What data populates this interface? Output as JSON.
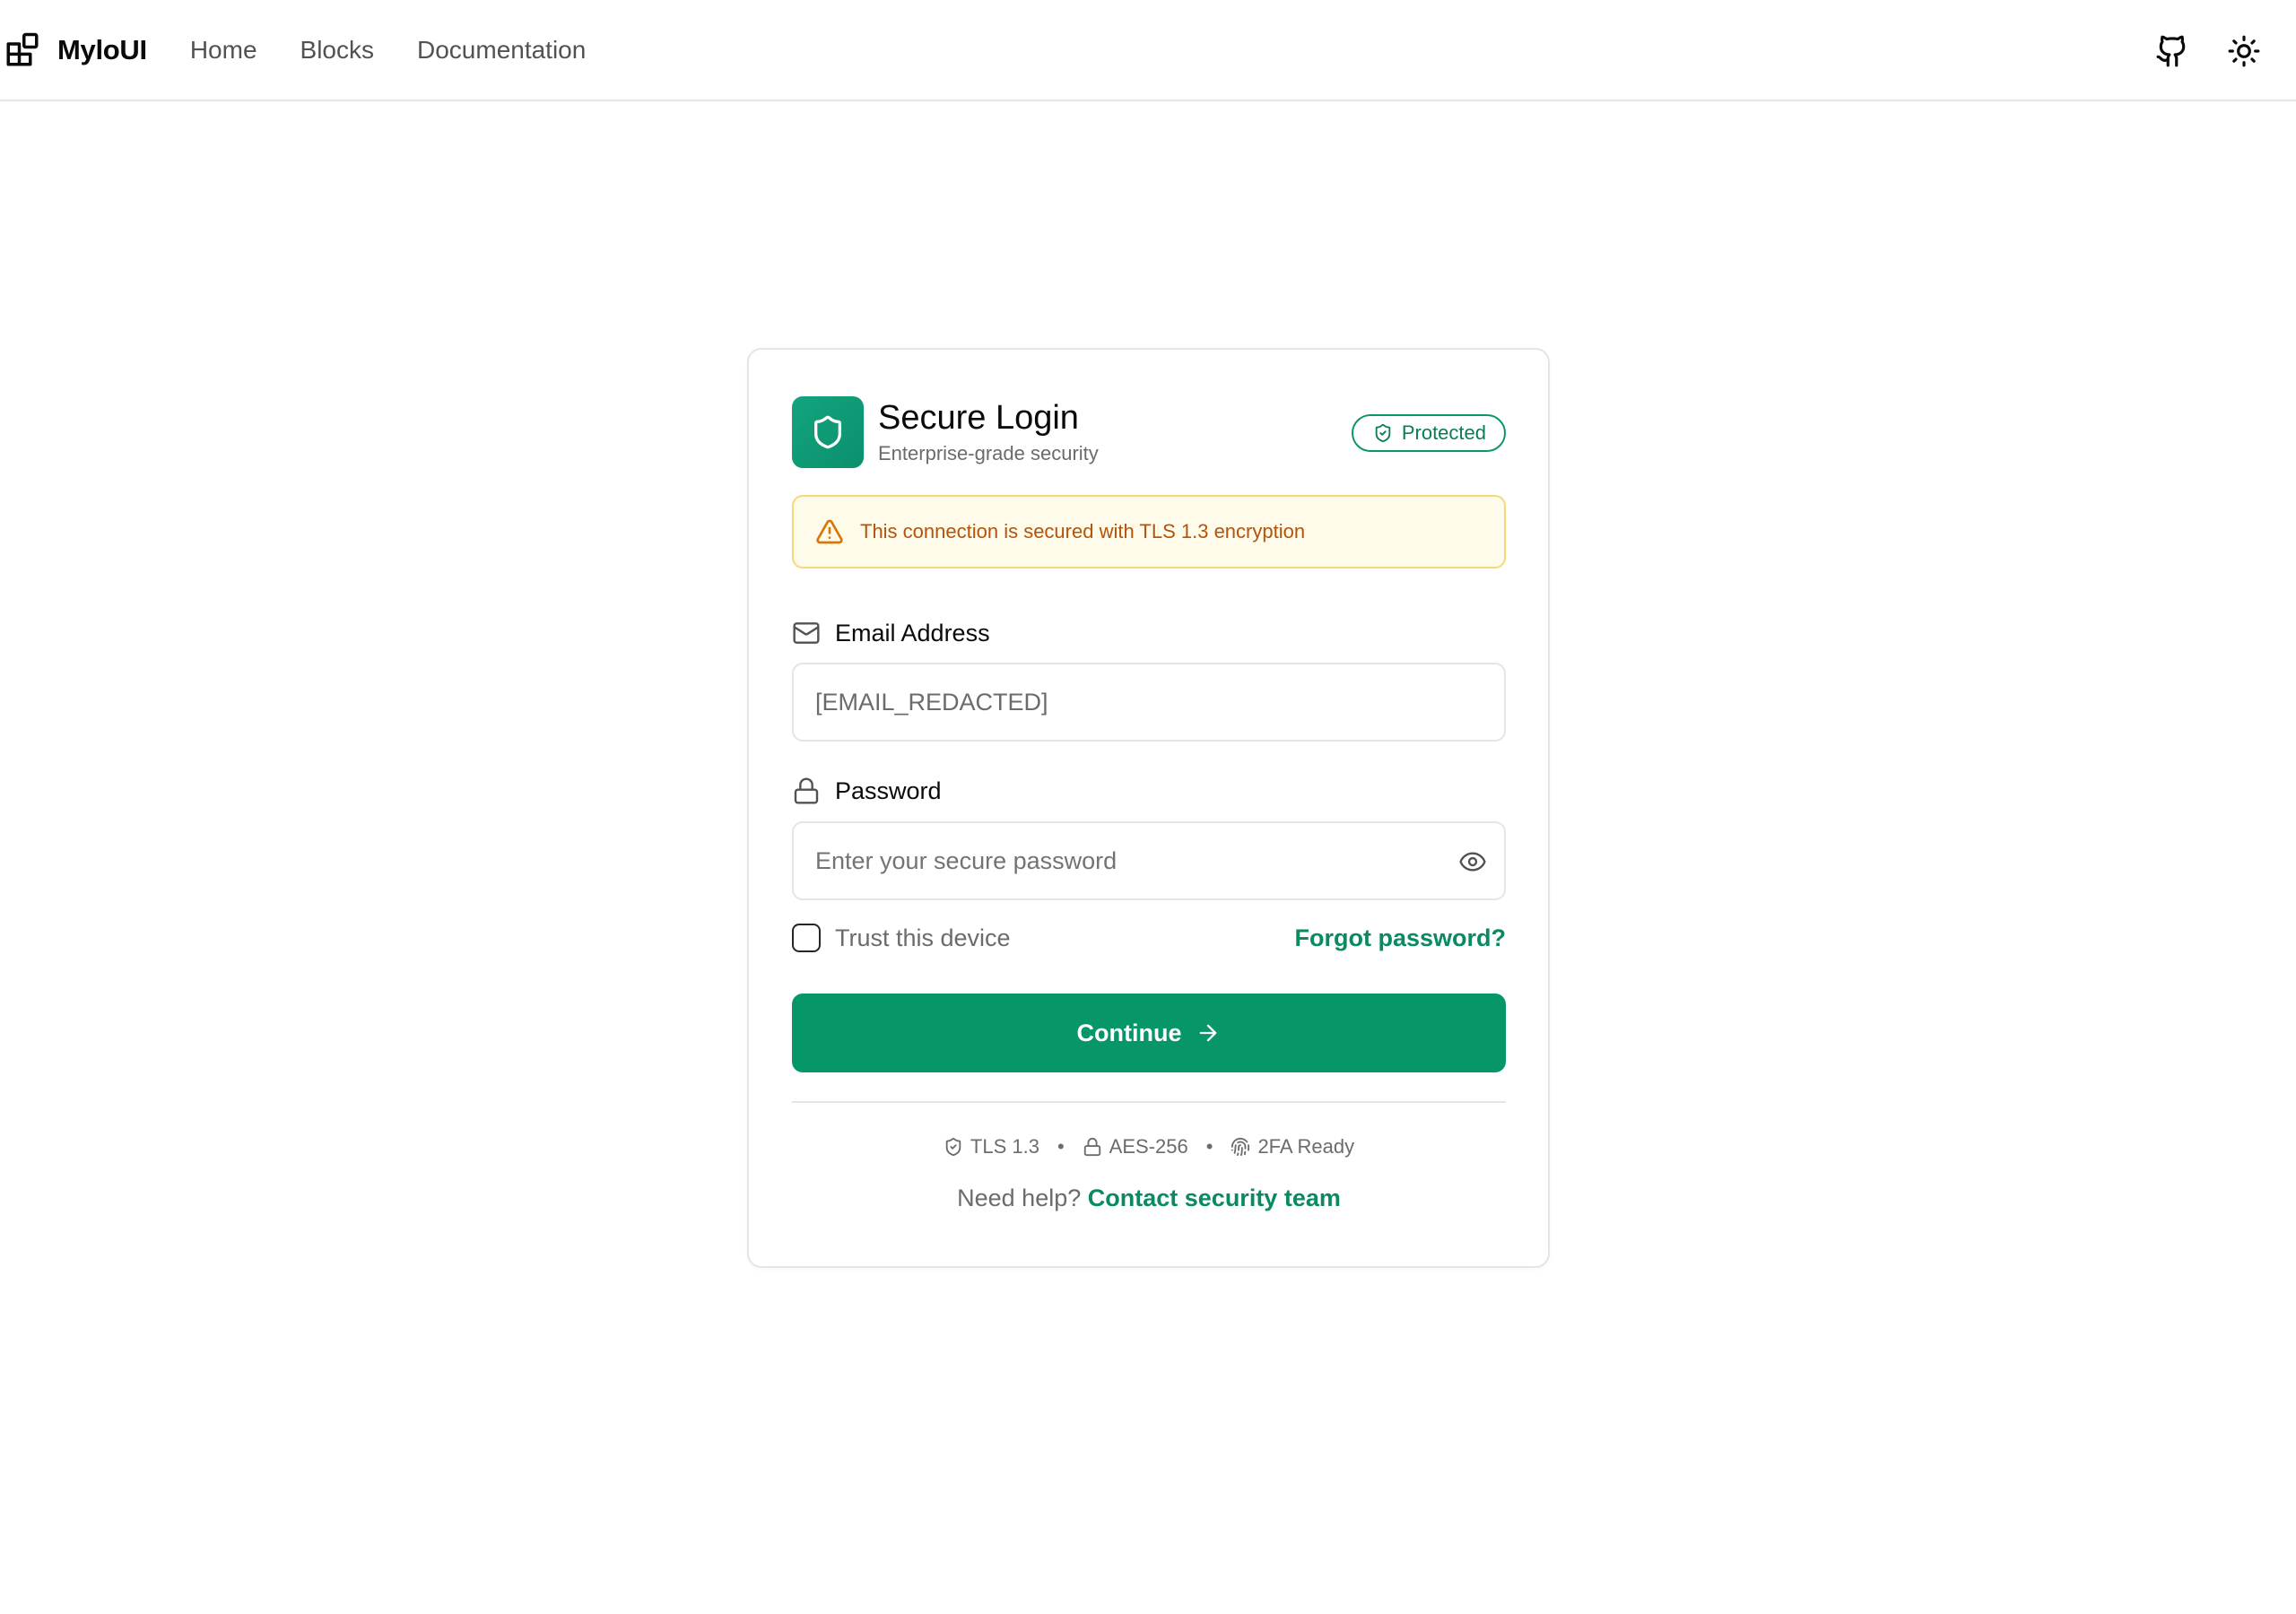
{
  "header": {
    "brand": "MyloUI",
    "nav": [
      "Home",
      "Blocks",
      "Documentation"
    ],
    "icons": [
      "github-icon",
      "sun-icon"
    ]
  },
  "card": {
    "title": "Secure Login",
    "subtitle": "Enterprise-grade security",
    "badge": "Protected",
    "alert": "This connection is secured with TLS 1.3 encryption",
    "email": {
      "label": "Email Address",
      "value": "[EMAIL_REDACTED]"
    },
    "password": {
      "label": "Password",
      "placeholder": "Enter your secure password"
    },
    "trust_label": "Trust this device",
    "forgot": "Forgot password?",
    "submit": "Continue",
    "security": [
      "TLS 1.3",
      "AES-256",
      "2FA Ready"
    ],
    "help_text": "Need help?",
    "help_link": "Contact security team"
  },
  "colors": {
    "accent": "#07966a",
    "warning_bg": "#fffbea",
    "warning_text": "#b45309"
  }
}
